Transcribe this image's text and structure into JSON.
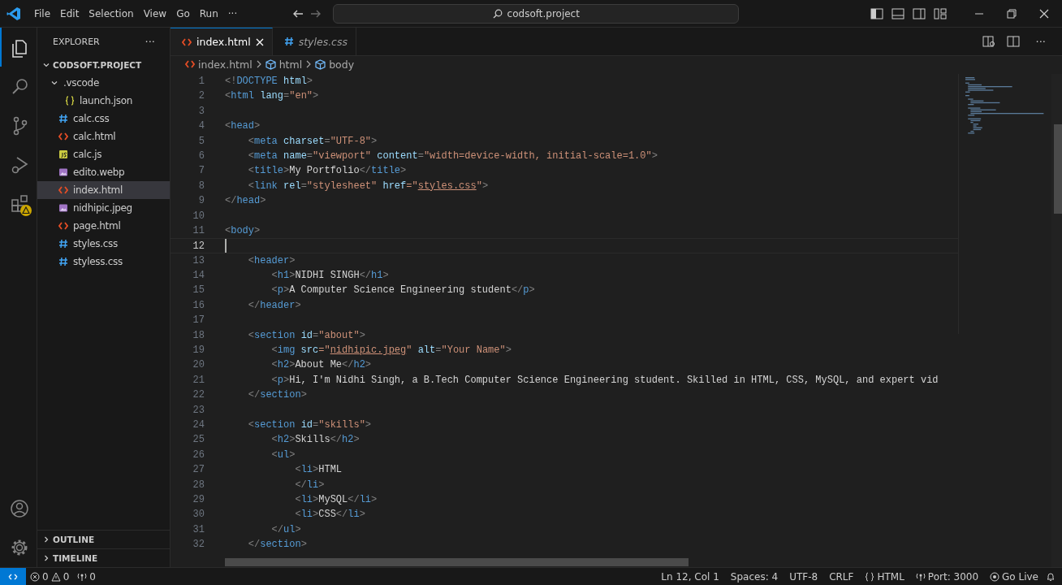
{
  "title_bar": {
    "menu": [
      "File",
      "Edit",
      "Selection",
      "View",
      "Go",
      "Run"
    ],
    "more": "···",
    "search": "codsoft.project"
  },
  "activity_bar": [
    {
      "selected": true,
      "warning": false
    },
    {
      "selected": false,
      "warning": false
    },
    {
      "selected": false,
      "warning": false
    },
    {
      "selected": false,
      "warning": false
    },
    {
      "selected": false,
      "warning": true
    }
  ],
  "sidebar": {
    "title": "EXPLORER",
    "more": "···",
    "folder": "CODSOFT.PROJECT",
    "expanded": true,
    "items": [
      {
        "label": ".vscode",
        "kind": "folder",
        "expanded": true,
        "selected": false,
        "children": [
          {
            "label": "launch.json",
            "kind": "json",
            "selected": false
          }
        ]
      },
      {
        "label": "calc.css",
        "kind": "css",
        "selected": false
      },
      {
        "label": "calc.html",
        "kind": "html",
        "selected": false
      },
      {
        "label": "calc.js",
        "kind": "js",
        "selected": false
      },
      {
        "label": "edito.webp",
        "kind": "image",
        "selected": false
      },
      {
        "label": "index.html",
        "kind": "html",
        "selected": true
      },
      {
        "label": "nidhipic.jpeg",
        "kind": "image",
        "selected": false
      },
      {
        "label": "page.html",
        "kind": "html",
        "selected": false
      },
      {
        "label": "styles.css",
        "kind": "css",
        "selected": false
      },
      {
        "label": "styless.css",
        "kind": "css",
        "selected": false
      }
    ],
    "sections": [
      {
        "label": "OUTLINE",
        "expanded": false
      },
      {
        "label": "TIMELINE",
        "expanded": false
      }
    ]
  },
  "tabs": [
    {
      "label": "index.html",
      "kind": "html",
      "selected": true,
      "preview": false
    },
    {
      "label": "styles.css",
      "kind": "css",
      "selected": false,
      "preview": true
    }
  ],
  "editor_actions_more": "···",
  "breadcrumb": [
    {
      "label": "index.html",
      "kind": "html"
    },
    {
      "label": "html",
      "kind": "element"
    },
    {
      "label": "body",
      "kind": "element"
    }
  ],
  "code": {
    "lines": [
      {
        "number": "1",
        "current": false,
        "tokens": [
          {
            "text": "<!",
            "kind": "punct"
          },
          {
            "text": "DOCTYPE",
            "kind": "tag"
          },
          {
            "text": " html",
            "kind": "attr"
          },
          {
            "text": ">",
            "kind": "punct"
          }
        ]
      },
      {
        "number": "2",
        "current": false,
        "tokens": [
          {
            "text": "<",
            "kind": "punct"
          },
          {
            "text": "html",
            "kind": "tag"
          },
          {
            "text": " lang",
            "kind": "attr"
          },
          {
            "text": "=",
            "kind": "punct"
          },
          {
            "text": "\"en\"",
            "kind": "string"
          },
          {
            "text": ">",
            "kind": "punct"
          }
        ]
      },
      {
        "number": "3",
        "current": false
      },
      {
        "number": "4",
        "current": false,
        "tokens": [
          {
            "text": "<",
            "kind": "punct"
          },
          {
            "text": "head",
            "kind": "tag"
          },
          {
            "text": ">",
            "kind": "punct"
          }
        ]
      },
      {
        "number": "5",
        "current": false,
        "tokens": [
          {
            "text": "    <",
            "kind": "punct"
          },
          {
            "text": "meta",
            "kind": "tag"
          },
          {
            "text": " charset",
            "kind": "attr"
          },
          {
            "text": "=",
            "kind": "punct"
          },
          {
            "text": "\"UTF-8\"",
            "kind": "string"
          },
          {
            "text": ">",
            "kind": "punct"
          }
        ]
      },
      {
        "number": "6",
        "current": false,
        "tokens": [
          {
            "text": "    <",
            "kind": "punct"
          },
          {
            "text": "meta",
            "kind": "tag"
          },
          {
            "text": " name",
            "kind": "attr"
          },
          {
            "text": "=",
            "kind": "punct"
          },
          {
            "text": "\"viewport\"",
            "kind": "string"
          },
          {
            "text": " content",
            "kind": "attr"
          },
          {
            "text": "=",
            "kind": "punct"
          },
          {
            "text": "\"width=device-width, initial-scale=1.0\"",
            "kind": "string"
          },
          {
            "text": ">",
            "kind": "punct"
          }
        ]
      },
      {
        "number": "7",
        "current": false,
        "tokens": [
          {
            "text": "    <",
            "kind": "punct"
          },
          {
            "text": "title",
            "kind": "tag"
          },
          {
            "text": ">",
            "kind": "punct"
          },
          {
            "text": "My Portfolio",
            "kind": "text"
          },
          {
            "text": "</",
            "kind": "punct"
          },
          {
            "text": "title",
            "kind": "tag"
          },
          {
            "text": ">",
            "kind": "punct"
          }
        ]
      },
      {
        "number": "8",
        "current": false,
        "tokens": [
          {
            "text": "    <",
            "kind": "punct"
          },
          {
            "text": "link",
            "kind": "tag"
          },
          {
            "text": " rel",
            "kind": "attr"
          },
          {
            "text": "=",
            "kind": "punct"
          },
          {
            "text": "\"stylesheet\"",
            "kind": "string"
          },
          {
            "text": " href",
            "kind": "attr"
          },
          {
            "text": "=\"",
            "kind": "string"
          },
          {
            "text": "styles.css",
            "kind": "link"
          },
          {
            "text": "\"",
            "kind": "string"
          },
          {
            "text": ">",
            "kind": "punct"
          }
        ]
      },
      {
        "number": "9",
        "current": false,
        "tokens": [
          {
            "text": "</",
            "kind": "punct"
          },
          {
            "text": "head",
            "kind": "tag"
          },
          {
            "text": ">",
            "kind": "punct"
          }
        ]
      },
      {
        "number": "10",
        "current": false
      },
      {
        "number": "11",
        "current": false,
        "tokens": [
          {
            "text": "<",
            "kind": "punct"
          },
          {
            "text": "body",
            "kind": "tag"
          },
          {
            "text": ">",
            "kind": "punct"
          }
        ]
      },
      {
        "number": "12",
        "current": true
      },
      {
        "number": "13",
        "current": false,
        "tokens": [
          {
            "text": "    <",
            "kind": "punct"
          },
          {
            "text": "header",
            "kind": "tag"
          },
          {
            "text": ">",
            "kind": "punct"
          }
        ]
      },
      {
        "number": "14",
        "current": false,
        "tokens": [
          {
            "text": "        <",
            "kind": "punct"
          },
          {
            "text": "h1",
            "kind": "tag"
          },
          {
            "text": ">",
            "kind": "punct"
          },
          {
            "text": "NIDHI SINGH",
            "kind": "text"
          },
          {
            "text": "</",
            "kind": "punct"
          },
          {
            "text": "h1",
            "kind": "tag"
          },
          {
            "text": ">",
            "kind": "punct"
          }
        ]
      },
      {
        "number": "15",
        "current": false,
        "tokens": [
          {
            "text": "        <",
            "kind": "punct"
          },
          {
            "text": "p",
            "kind": "tag"
          },
          {
            "text": ">",
            "kind": "punct"
          },
          {
            "text": "A Computer Science Engineering student",
            "kind": "text"
          },
          {
            "text": "</",
            "kind": "punct"
          },
          {
            "text": "p",
            "kind": "tag"
          },
          {
            "text": ">",
            "kind": "punct"
          }
        ]
      },
      {
        "number": "16",
        "current": false,
        "tokens": [
          {
            "text": "    </",
            "kind": "punct"
          },
          {
            "text": "header",
            "kind": "tag"
          },
          {
            "text": ">",
            "kind": "punct"
          }
        ]
      },
      {
        "number": "17",
        "current": false
      },
      {
        "number": "18",
        "current": false,
        "tokens": [
          {
            "text": "    <",
            "kind": "punct"
          },
          {
            "text": "section",
            "kind": "tag"
          },
          {
            "text": " id",
            "kind": "attr"
          },
          {
            "text": "=",
            "kind": "punct"
          },
          {
            "text": "\"about\"",
            "kind": "string"
          },
          {
            "text": ">",
            "kind": "punct"
          }
        ]
      },
      {
        "number": "19",
        "current": false,
        "tokens": [
          {
            "text": "        <",
            "kind": "punct"
          },
          {
            "text": "img",
            "kind": "tag"
          },
          {
            "text": " src",
            "kind": "attr"
          },
          {
            "text": "=\"",
            "kind": "string"
          },
          {
            "text": "nidhipic.jpeg",
            "kind": "link"
          },
          {
            "text": "\"",
            "kind": "string"
          },
          {
            "text": " alt",
            "kind": "attr"
          },
          {
            "text": "=",
            "kind": "punct"
          },
          {
            "text": "\"Your Name\"",
            "kind": "string"
          },
          {
            "text": ">",
            "kind": "punct"
          }
        ]
      },
      {
        "number": "20",
        "current": false,
        "tokens": [
          {
            "text": "        <",
            "kind": "punct"
          },
          {
            "text": "h2",
            "kind": "tag"
          },
          {
            "text": ">",
            "kind": "punct"
          },
          {
            "text": "About Me",
            "kind": "text"
          },
          {
            "text": "</",
            "kind": "punct"
          },
          {
            "text": "h2",
            "kind": "tag"
          },
          {
            "text": ">",
            "kind": "punct"
          }
        ]
      },
      {
        "number": "21",
        "current": false,
        "tokens": [
          {
            "text": "        <",
            "kind": "punct"
          },
          {
            "text": "p",
            "kind": "tag"
          },
          {
            "text": ">",
            "kind": "punct"
          },
          {
            "text": "Hi, I'm Nidhi Singh, a B.Tech Computer Science Engineering student. Skilled in HTML, CSS, MySQL, and expert vid",
            "kind": "text"
          }
        ]
      },
      {
        "number": "22",
        "current": false,
        "tokens": [
          {
            "text": "    </",
            "kind": "punct"
          },
          {
            "text": "section",
            "kind": "tag"
          },
          {
            "text": ">",
            "kind": "punct"
          }
        ]
      },
      {
        "number": "23",
        "current": false
      },
      {
        "number": "24",
        "current": false,
        "tokens": [
          {
            "text": "    <",
            "kind": "punct"
          },
          {
            "text": "section",
            "kind": "tag"
          },
          {
            "text": " id",
            "kind": "attr"
          },
          {
            "text": "=",
            "kind": "punct"
          },
          {
            "text": "\"skills\"",
            "kind": "string"
          },
          {
            "text": ">",
            "kind": "punct"
          }
        ]
      },
      {
        "number": "25",
        "current": false,
        "tokens": [
          {
            "text": "        <",
            "kind": "punct"
          },
          {
            "text": "h2",
            "kind": "tag"
          },
          {
            "text": ">",
            "kind": "punct"
          },
          {
            "text": "Skills",
            "kind": "text"
          },
          {
            "text": "</",
            "kind": "punct"
          },
          {
            "text": "h2",
            "kind": "tag"
          },
          {
            "text": ">",
            "kind": "punct"
          }
        ]
      },
      {
        "number": "26",
        "current": false,
        "tokens": [
          {
            "text": "        <",
            "kind": "punct"
          },
          {
            "text": "ul",
            "kind": "tag"
          },
          {
            "text": ">",
            "kind": "punct"
          }
        ]
      },
      {
        "number": "27",
        "current": false,
        "tokens": [
          {
            "text": "            <",
            "kind": "punct"
          },
          {
            "text": "li",
            "kind": "tag"
          },
          {
            "text": ">",
            "kind": "punct"
          },
          {
            "text": "HTML",
            "kind": "text"
          }
        ]
      },
      {
        "number": "28",
        "current": false,
        "tokens": [
          {
            "text": "            </",
            "kind": "punct"
          },
          {
            "text": "li",
            "kind": "tag"
          },
          {
            "text": ">",
            "kind": "punct"
          }
        ]
      },
      {
        "number": "29",
        "current": false,
        "tokens": [
          {
            "text": "            <",
            "kind": "punct"
          },
          {
            "text": "li",
            "kind": "tag"
          },
          {
            "text": ">",
            "kind": "punct"
          },
          {
            "text": "MySQL",
            "kind": "text"
          },
          {
            "text": "</",
            "kind": "punct"
          },
          {
            "text": "li",
            "kind": "tag"
          },
          {
            "text": ">",
            "kind": "punct"
          }
        ]
      },
      {
        "number": "30",
        "current": false,
        "tokens": [
          {
            "text": "            <",
            "kind": "punct"
          },
          {
            "text": "li",
            "kind": "tag"
          },
          {
            "text": ">",
            "kind": "punct"
          },
          {
            "text": "CSS",
            "kind": "text"
          },
          {
            "text": "</",
            "kind": "punct"
          },
          {
            "text": "li",
            "kind": "tag"
          },
          {
            "text": ">",
            "kind": "punct"
          }
        ]
      },
      {
        "number": "31",
        "current": false,
        "tokens": [
          {
            "text": "        </",
            "kind": "punct"
          },
          {
            "text": "ul",
            "kind": "tag"
          },
          {
            "text": ">",
            "kind": "punct"
          }
        ]
      },
      {
        "number": "32",
        "current": false,
        "tokens": [
          {
            "text": "    </",
            "kind": "punct"
          },
          {
            "text": "section",
            "kind": "tag"
          },
          {
            "text": ">",
            "kind": "punct"
          }
        ]
      }
    ]
  },
  "status_bar": {
    "errors": "0",
    "warnings": "0",
    "ports": "0",
    "position": "Ln 12, Col 1",
    "spaces": "Spaces: 4",
    "encoding": "UTF-8",
    "eol": "CRLF",
    "language": "HTML",
    "port": "Port: 3000",
    "live": "Go Live"
  }
}
